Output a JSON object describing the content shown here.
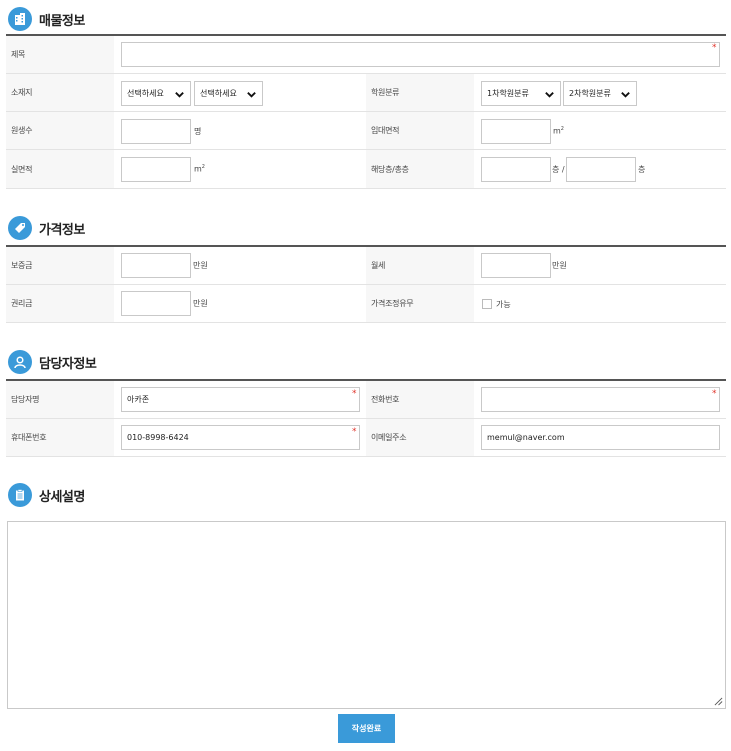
{
  "sections": {
    "property": {
      "title": "매물정보",
      "rows": {
        "title_label": "제목",
        "location_label": "소재지",
        "location_select1": "선택하세요",
        "location_select2": "선택하세요",
        "category_label": "학원분류",
        "category_select1": "1차학원분류",
        "category_select2": "2차학원분류",
        "students_label": "원생수",
        "students_unit": "명",
        "rent_area_label": "임대면적",
        "rent_area_unit": "m",
        "real_area_label": "실면적",
        "real_area_unit": "m",
        "floor_label": "해당층/총층",
        "floor_unit1": "층 /",
        "floor_unit2": "층"
      }
    },
    "price": {
      "title": "가격정보",
      "rows": {
        "deposit_label": "보증금",
        "deposit_unit": "만원",
        "monthly_label": "월세",
        "monthly_unit": "만원",
        "premium_label": "권리금",
        "premium_unit": "만원",
        "negotiable_label": "가격조정유무",
        "negotiable_option": "가능"
      }
    },
    "contact": {
      "title": "담당자정보",
      "rows": {
        "name_label": "담당자명",
        "name_value": "아카존",
        "phone_label": "전화번호",
        "phone_value": "",
        "mobile_label": "휴대폰번호",
        "mobile_value": "010-8998-6424",
        "email_label": "이메일주소",
        "email_value": "memul@naver.com"
      }
    },
    "detail": {
      "title": "상세설명"
    }
  },
  "required_mark": "*",
  "area_superscript": "2",
  "submit_label": "작성완료",
  "colors": {
    "accent": "#3a9ad9",
    "required": "#e0342b",
    "label_bg": "#f7f7f7"
  },
  "icons": {
    "property": "building-icon",
    "price": "tag-icon",
    "contact": "person-icon",
    "detail": "clipboard-icon"
  }
}
